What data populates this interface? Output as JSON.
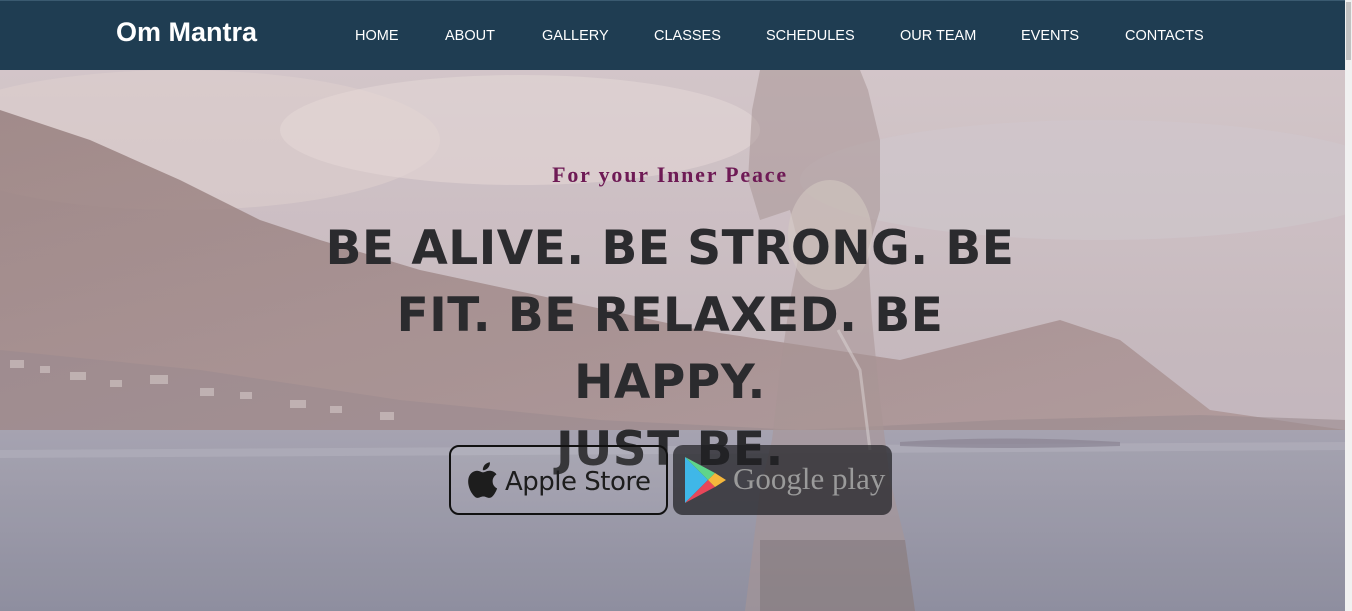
{
  "brand": "Om Mantra",
  "nav": {
    "items": [
      {
        "label": "HOME"
      },
      {
        "label": "ABOUT"
      },
      {
        "label": "GALLERY"
      },
      {
        "label": "CLASSES"
      },
      {
        "label": "SCHEDULES"
      },
      {
        "label": "OUR TEAM"
      },
      {
        "label": "EVENTS"
      },
      {
        "label": "CONTACTS"
      }
    ]
  },
  "hero": {
    "tagline": "For your Inner Peace",
    "headline_lines": [
      "BE ALIVE. BE STRONG. BE",
      "FIT. BE RELAXED. BE HAPPY.",
      "JUST BE."
    ],
    "apple_button": {
      "label": "Apple Store",
      "icon": "apple-icon"
    },
    "google_button": {
      "label": "Google play",
      "icon": "google-play-icon"
    }
  },
  "colors": {
    "navbar": "#1f3d52",
    "tagline": "#6e1a55",
    "headline": "#2b2b2e"
  }
}
